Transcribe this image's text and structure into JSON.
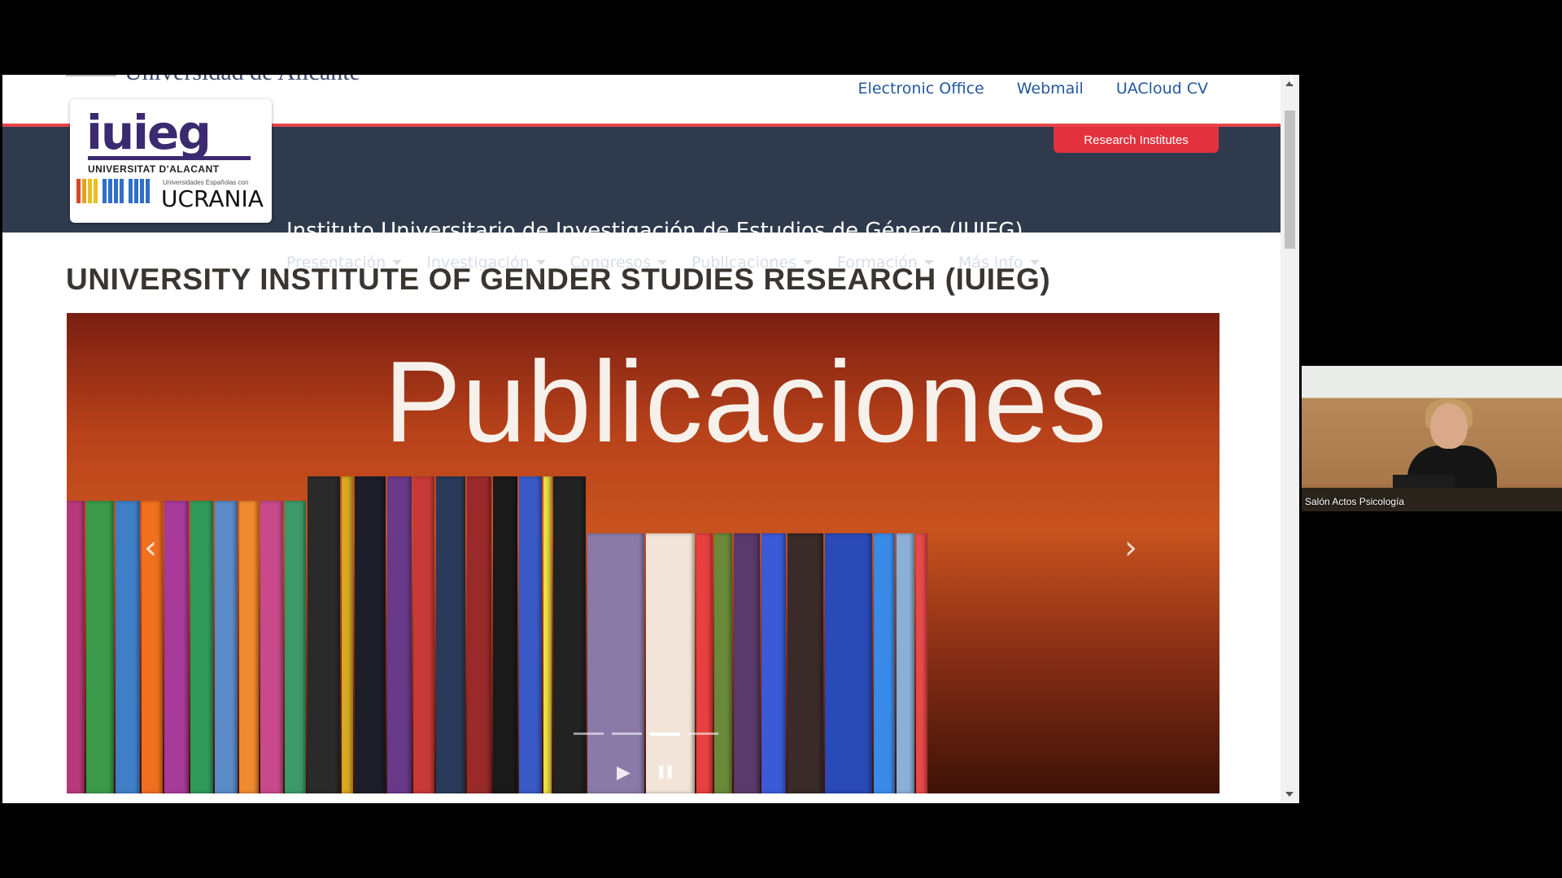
{
  "university": {
    "name": "Universidad de Alicante"
  },
  "top_links": [
    "Electronic Office",
    "Webmail",
    "UACloud CV"
  ],
  "research_button": "Research Institutes",
  "logo": {
    "main": "iuieg",
    "sub": "UNIVERSITAT D'ALACANT",
    "tagline": "Universidades Españolas con",
    "country": "UCRANIA"
  },
  "site_title": "Instituto Universitario de Investigación de Estudios de Género (IUIEG)",
  "nav": [
    "Presentación",
    "Investigación",
    "Congresos",
    "Publicaciones",
    "Formación",
    "Más info"
  ],
  "heading": "UNIVERSITY INSTITUTE OF GENDER STUDIES RESEARCH (IUIEG)",
  "carousel": {
    "slide_text": "Publicaciones",
    "slide_count": 4,
    "active_index": 2,
    "prev": "‹",
    "next": "›",
    "play": "▶",
    "pause": "❚❚"
  },
  "video": {
    "label": "Salón Actos Psicología"
  },
  "colors": {
    "accent": "#e3323e",
    "header": "#2f3b4d",
    "link": "#24589c",
    "logo": "#3b2a70"
  }
}
